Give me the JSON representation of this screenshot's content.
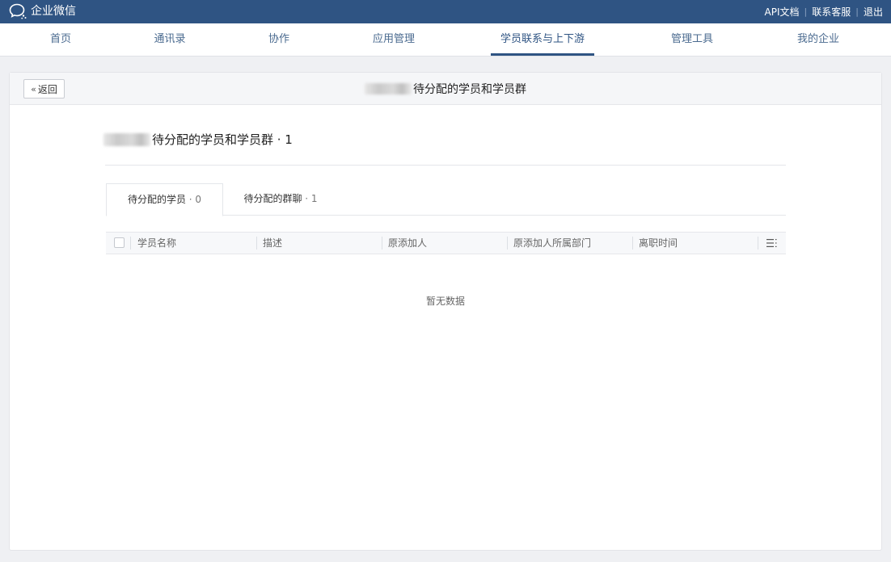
{
  "topbar": {
    "brand": "企业微信",
    "links": [
      "API文档",
      "联系客服",
      "退出"
    ]
  },
  "nav": {
    "items": [
      "首页",
      "通讯录",
      "协作",
      "应用管理",
      "学员联系与上下游",
      "管理工具",
      "我的企业"
    ],
    "active_index": 4
  },
  "page": {
    "back_label": "返回",
    "title": "待分配的学员和学员群",
    "subtitle": "待分配的学员和学员群 · 1"
  },
  "tabs": [
    {
      "label": "待分配的学员",
      "count": " · 0"
    },
    {
      "label": "待分配的群聊",
      "count": " · 1"
    }
  ],
  "table": {
    "columns": [
      "学员名称",
      "描述",
      "原添加人",
      "原添加人所属部门",
      "离职时间"
    ],
    "empty_text": "暂无数据"
  },
  "colors": {
    "brand": "#2f5483",
    "nav_text": "#4a6a8f",
    "background": "#eff0f3"
  }
}
